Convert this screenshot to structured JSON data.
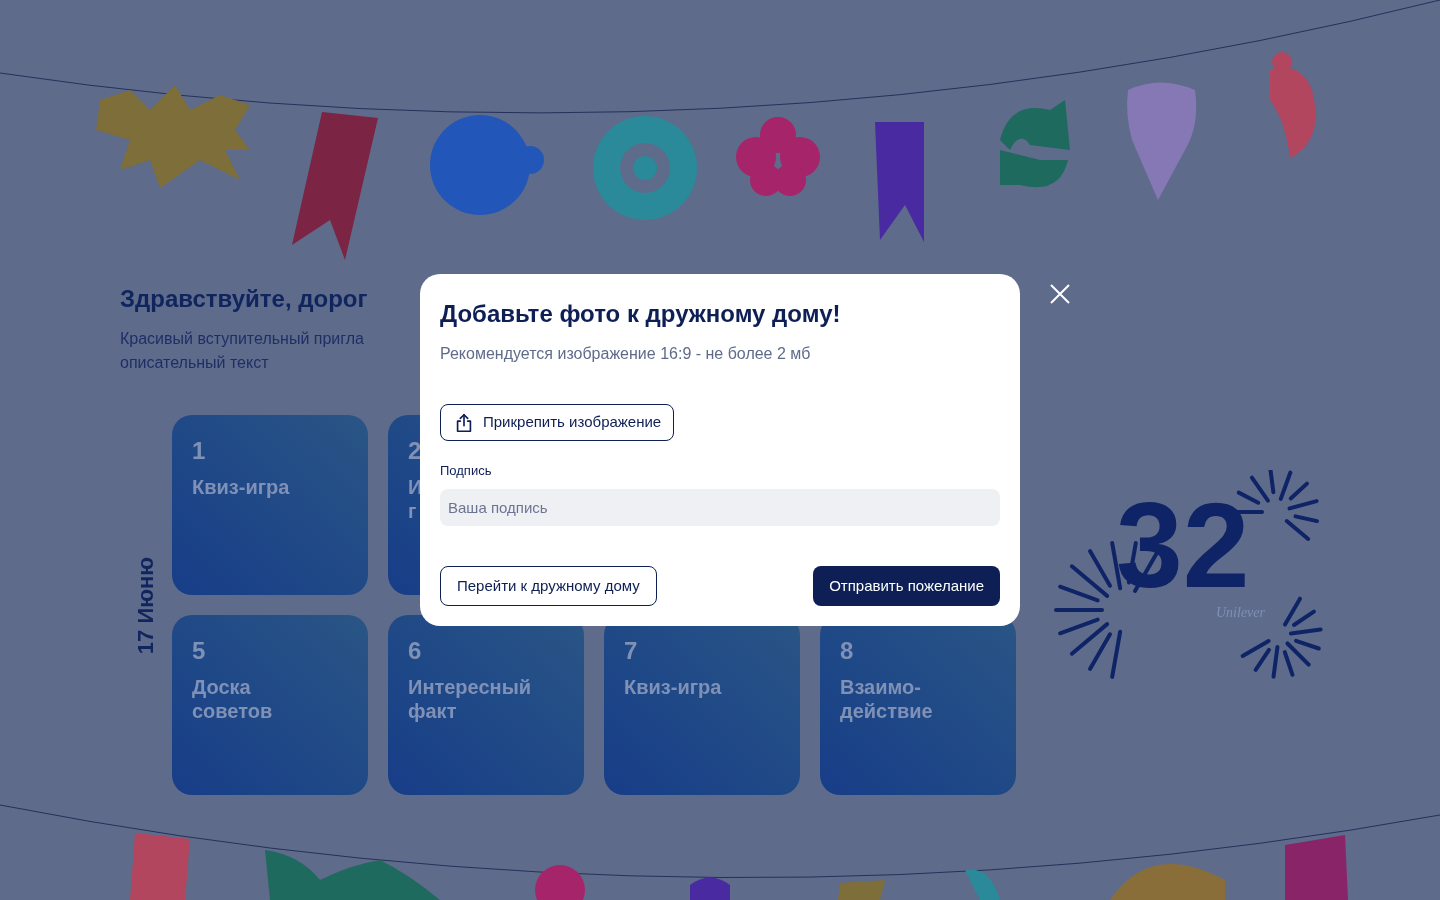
{
  "intro": {
    "heading": "Здравствуйте, дорог",
    "lines": [
      "Красивый вступительный пригла",
      "описательный текст"
    ]
  },
  "date_label": "17 Июню",
  "tile_rows": [
    [
      {
        "number": "1",
        "title": [
          "Квиз-игра"
        ]
      },
      {
        "number": "2",
        "title": [
          "И",
          "г"
        ]
      }
    ],
    [
      {
        "number": "5",
        "title": [
          "Доска",
          "советов"
        ]
      },
      {
        "number": "6",
        "title": [
          "Интересный",
          "факт"
        ]
      },
      {
        "number": "7",
        "title": [
          "Квиз-игра"
        ]
      },
      {
        "number": "8",
        "title": [
          "Взаимо-",
          "действие"
        ]
      }
    ]
  ],
  "logo": {
    "number": "32",
    "wordmark": "Unilever"
  },
  "modal": {
    "title": "Добавьте фото к дружному дому!",
    "hint": "Рекомендуется изображение 16:9 - не более 2 мб",
    "attach_button": "Прикрепить изображение",
    "caption_label": "Подпись",
    "caption_field": {
      "placeholder": "Ваша подпись"
    },
    "secondary_button": "Перейти к дружному дому",
    "primary_button": "Отправить пожелание"
  }
}
